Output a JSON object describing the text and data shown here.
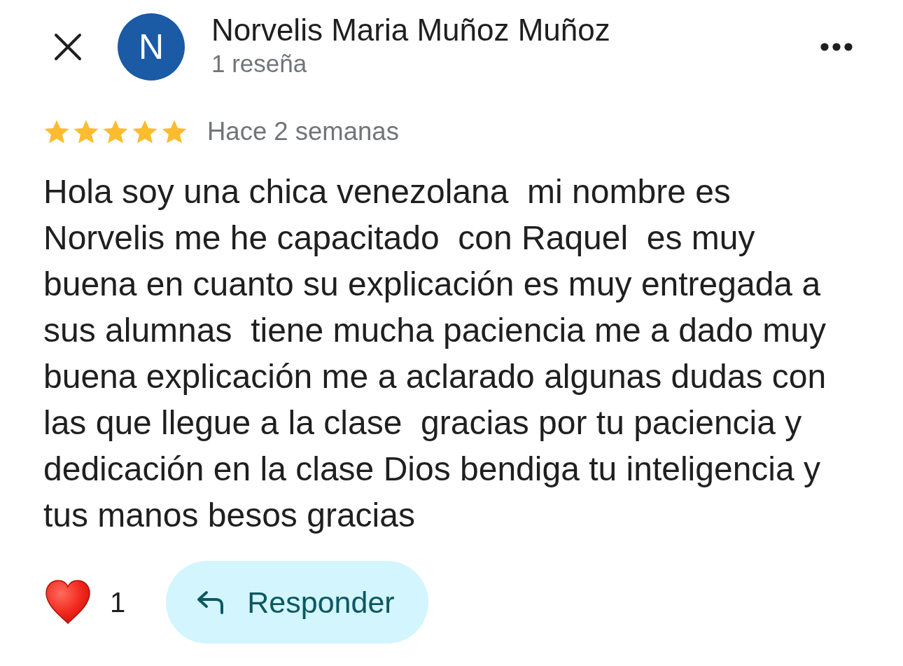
{
  "reviewer": {
    "avatar_letter": "N",
    "name": "Norvelis Maria Muñoz Muñoz",
    "review_count": "1 reseña"
  },
  "review": {
    "stars": 5,
    "time": "Hace 2 semanas",
    "text": "Hola soy una chica venezolana  mi nombre es Norvelis me he capacitado  con Raquel  es muy buena en cuanto su explicación es muy entregada a sus alumnas  tiene mucha paciencia me a dado muy buena explicación me a aclarado algunas dudas con las que llegue a la clase  gracias por tu paciencia y dedicación en la clase Dios bendiga tu inteligencia y tus manos besos gracias"
  },
  "reactions": {
    "count": "1"
  },
  "reply_button": {
    "label": "Responder"
  }
}
